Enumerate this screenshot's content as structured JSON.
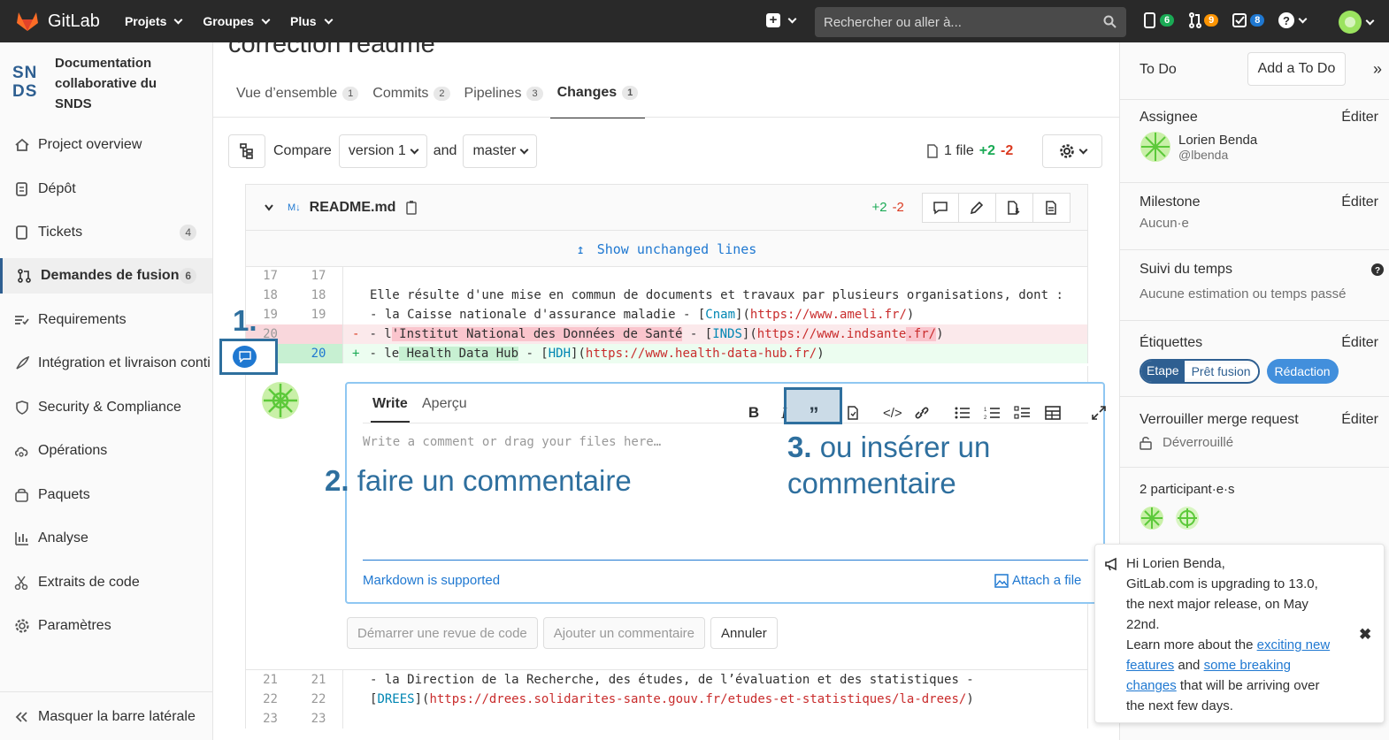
{
  "topbar": {
    "brand": "GitLab",
    "menu": [
      "Projets",
      "Groupes",
      "Plus"
    ],
    "search_placeholder": "Rechercher ou aller à...",
    "issues_count": "6",
    "mr_count": "9",
    "todo_count": "8"
  },
  "project": {
    "logo_line1": "SN",
    "logo_line2": "DS",
    "name_line1": "Documentation",
    "name_line2": "collaborative du",
    "name_line3": "SNDS"
  },
  "sidebar": {
    "items": [
      {
        "label": "Project overview"
      },
      {
        "label": "Dépôt"
      },
      {
        "label": "Tickets",
        "count": "4"
      },
      {
        "label": "Demandes de fusion",
        "count": "6"
      },
      {
        "label": "Requirements"
      },
      {
        "label": "Intégration et livraison conti"
      },
      {
        "label": "Security & Compliance"
      },
      {
        "label": "Opérations"
      },
      {
        "label": "Paquets"
      },
      {
        "label": "Analyse"
      },
      {
        "label": "Extraits de code"
      },
      {
        "label": "Paramètres"
      }
    ],
    "collapse_label": "Masquer la barre latérale"
  },
  "mr": {
    "title": "correction readme",
    "tabs": [
      {
        "label": "Vue d’ensemble",
        "count": "1"
      },
      {
        "label": "Commits",
        "count": "2"
      },
      {
        "label": "Pipelines",
        "count": "3"
      },
      {
        "label": "Changes",
        "count": "1"
      }
    ]
  },
  "compare": {
    "label": "Compare",
    "from": "version 1",
    "and": "and",
    "to": "master",
    "files": "1 file",
    "added": "+2",
    "removed": "-2"
  },
  "file": {
    "badge": "M↓",
    "name": "README.md",
    "added": "+2",
    "removed": "-2",
    "show_unchanged": "Show unchanged lines"
  },
  "diff_top": [
    {
      "old": "17",
      "new": "17",
      "sign": "",
      "text": ""
    },
    {
      "old": "18",
      "new": "18",
      "sign": "",
      "text": "Elle résulte d'une mise en commun de documents et travaux par plusieurs organisations, dont :"
    },
    {
      "old": "19",
      "new": "19",
      "sign": "",
      "text_a": "- la Caisse nationale d'assurance maladie - [",
      "ref": "Cnam",
      "text_b": "](",
      "url": "https://www.ameli.fr/",
      "text_c": ")"
    },
    {
      "old": "20",
      "new": "",
      "sign": "-",
      "text_a": "- l",
      "hl": "'Institut National des Données de Santé",
      "text_b": " - [",
      "ref": "INDS",
      "text_c": "](",
      "url": "https://www.indsante",
      "url2": ".fr/",
      "text_d": ")"
    },
    {
      "old": "",
      "new": "20",
      "sign": "+",
      "text_a": "- le",
      "hl": " Health Data Hub",
      "text_b": " - [",
      "ref": "HDH",
      "text_c": "](",
      "url": "https://www.health-data-hub.fr/",
      "text_d": ")"
    }
  ],
  "editor": {
    "tab_write": "Write",
    "tab_preview": "Aperçu",
    "placeholder": "Write a comment or drag your files here…",
    "markdown": "Markdown is supported",
    "attach": "Attach a file"
  },
  "buttons": {
    "start_review": "Démarrer une revue de code",
    "add_comment": "Ajouter un commentaire",
    "cancel": "Annuler"
  },
  "diff_bottom": [
    {
      "old": "21",
      "new": "21",
      "text": "- la Direction de la Recherche, des études, de l’évaluation et des statistiques -"
    },
    {
      "old": "22",
      "new": "22",
      "text_a": "[",
      "ref": "DREES",
      "text_b": "](",
      "url": "https://drees.solidarites-sante.gouv.fr/etudes-et-statistiques/la-drees/",
      "text_c": ")"
    },
    {
      "old": "23",
      "new": "23",
      "text": ""
    }
  ],
  "annotations": {
    "a1": "1.",
    "a2_num": "2.",
    "a2_text": "faire un commentaire",
    "a3_num": "3.",
    "a3_text_line1": "ou insérer un",
    "a3_text_line2": "commentaire",
    "color": "#2e6f9e"
  },
  "right": {
    "todo": "To Do",
    "add_todo": "Add a To Do",
    "assignee_label": "Assignee",
    "edit": "Éditer",
    "assignee_name": "Lorien Benda",
    "assignee_handle": "@lbenda",
    "milestone_label": "Milestone",
    "milestone_value": "Aucun·e",
    "time_label": "Suivi du temps",
    "time_value": "Aucune estimation ou temps passé",
    "labels_label": "Étiquettes",
    "label1_scope": "Etape",
    "label1_value": "Prêt fusion",
    "label2": "Rédaction",
    "lock_label": "Verrouiller merge request",
    "lock_value": "Déverrouillé",
    "participants": "2 participant·e·s"
  },
  "popup": {
    "line1": "Hi Lorien Benda,",
    "line2": "GitLab.com is upgrading to 13.0,",
    "line3": "the next major release, on May",
    "line4": "22nd.",
    "line5a": "Learn more about the ",
    "link1a": "exciting new",
    "link1b": "features",
    "mid": " and ",
    "link2a": "some breaking",
    "link2b": "changes",
    "line6": " that will be arriving over",
    "line7": "the next few days."
  }
}
